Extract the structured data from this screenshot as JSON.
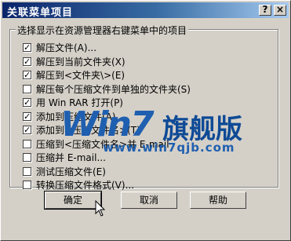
{
  "window": {
    "title": "关联菜单项目",
    "help_glyph": "?",
    "close_glyph": "×"
  },
  "group": {
    "label": "选择显示在资源管理器右键菜单中的项目"
  },
  "options": [
    {
      "label": "解压文件(A)...",
      "checked": true
    },
    {
      "label": "解压到当前文件夹(X)",
      "checked": true
    },
    {
      "label": "解压到<文件夹\\>(E)",
      "checked": true
    },
    {
      "label": "解压每个压缩文件到单独的文件夹(S)",
      "checked": false
    },
    {
      "label": "用 Win RAR 打开(P)",
      "checked": true
    },
    {
      "label": "添加到压缩文件(A)...",
      "checked": true
    },
    {
      "label": "添加到<压缩文件名>(T)",
      "checked": true
    },
    {
      "label": "压缩到<压缩文件名>并 E-mail",
      "checked": false
    },
    {
      "label": "压缩并 E-mail...",
      "checked": false
    },
    {
      "label": "测试压缩文件(E)",
      "checked": false
    },
    {
      "label": "转换压缩文件格式(V)...",
      "checked": false
    }
  ],
  "buttons": {
    "ok": "确定",
    "cancel": "取消",
    "help": "帮助"
  },
  "watermark": {
    "logo": "Win7",
    "text": "旗舰版",
    "url": "www.win7qjb.com"
  },
  "colors": {
    "face": "#d4d0c8",
    "title_start": "#0a246a",
    "title_end": "#a6caf0"
  }
}
